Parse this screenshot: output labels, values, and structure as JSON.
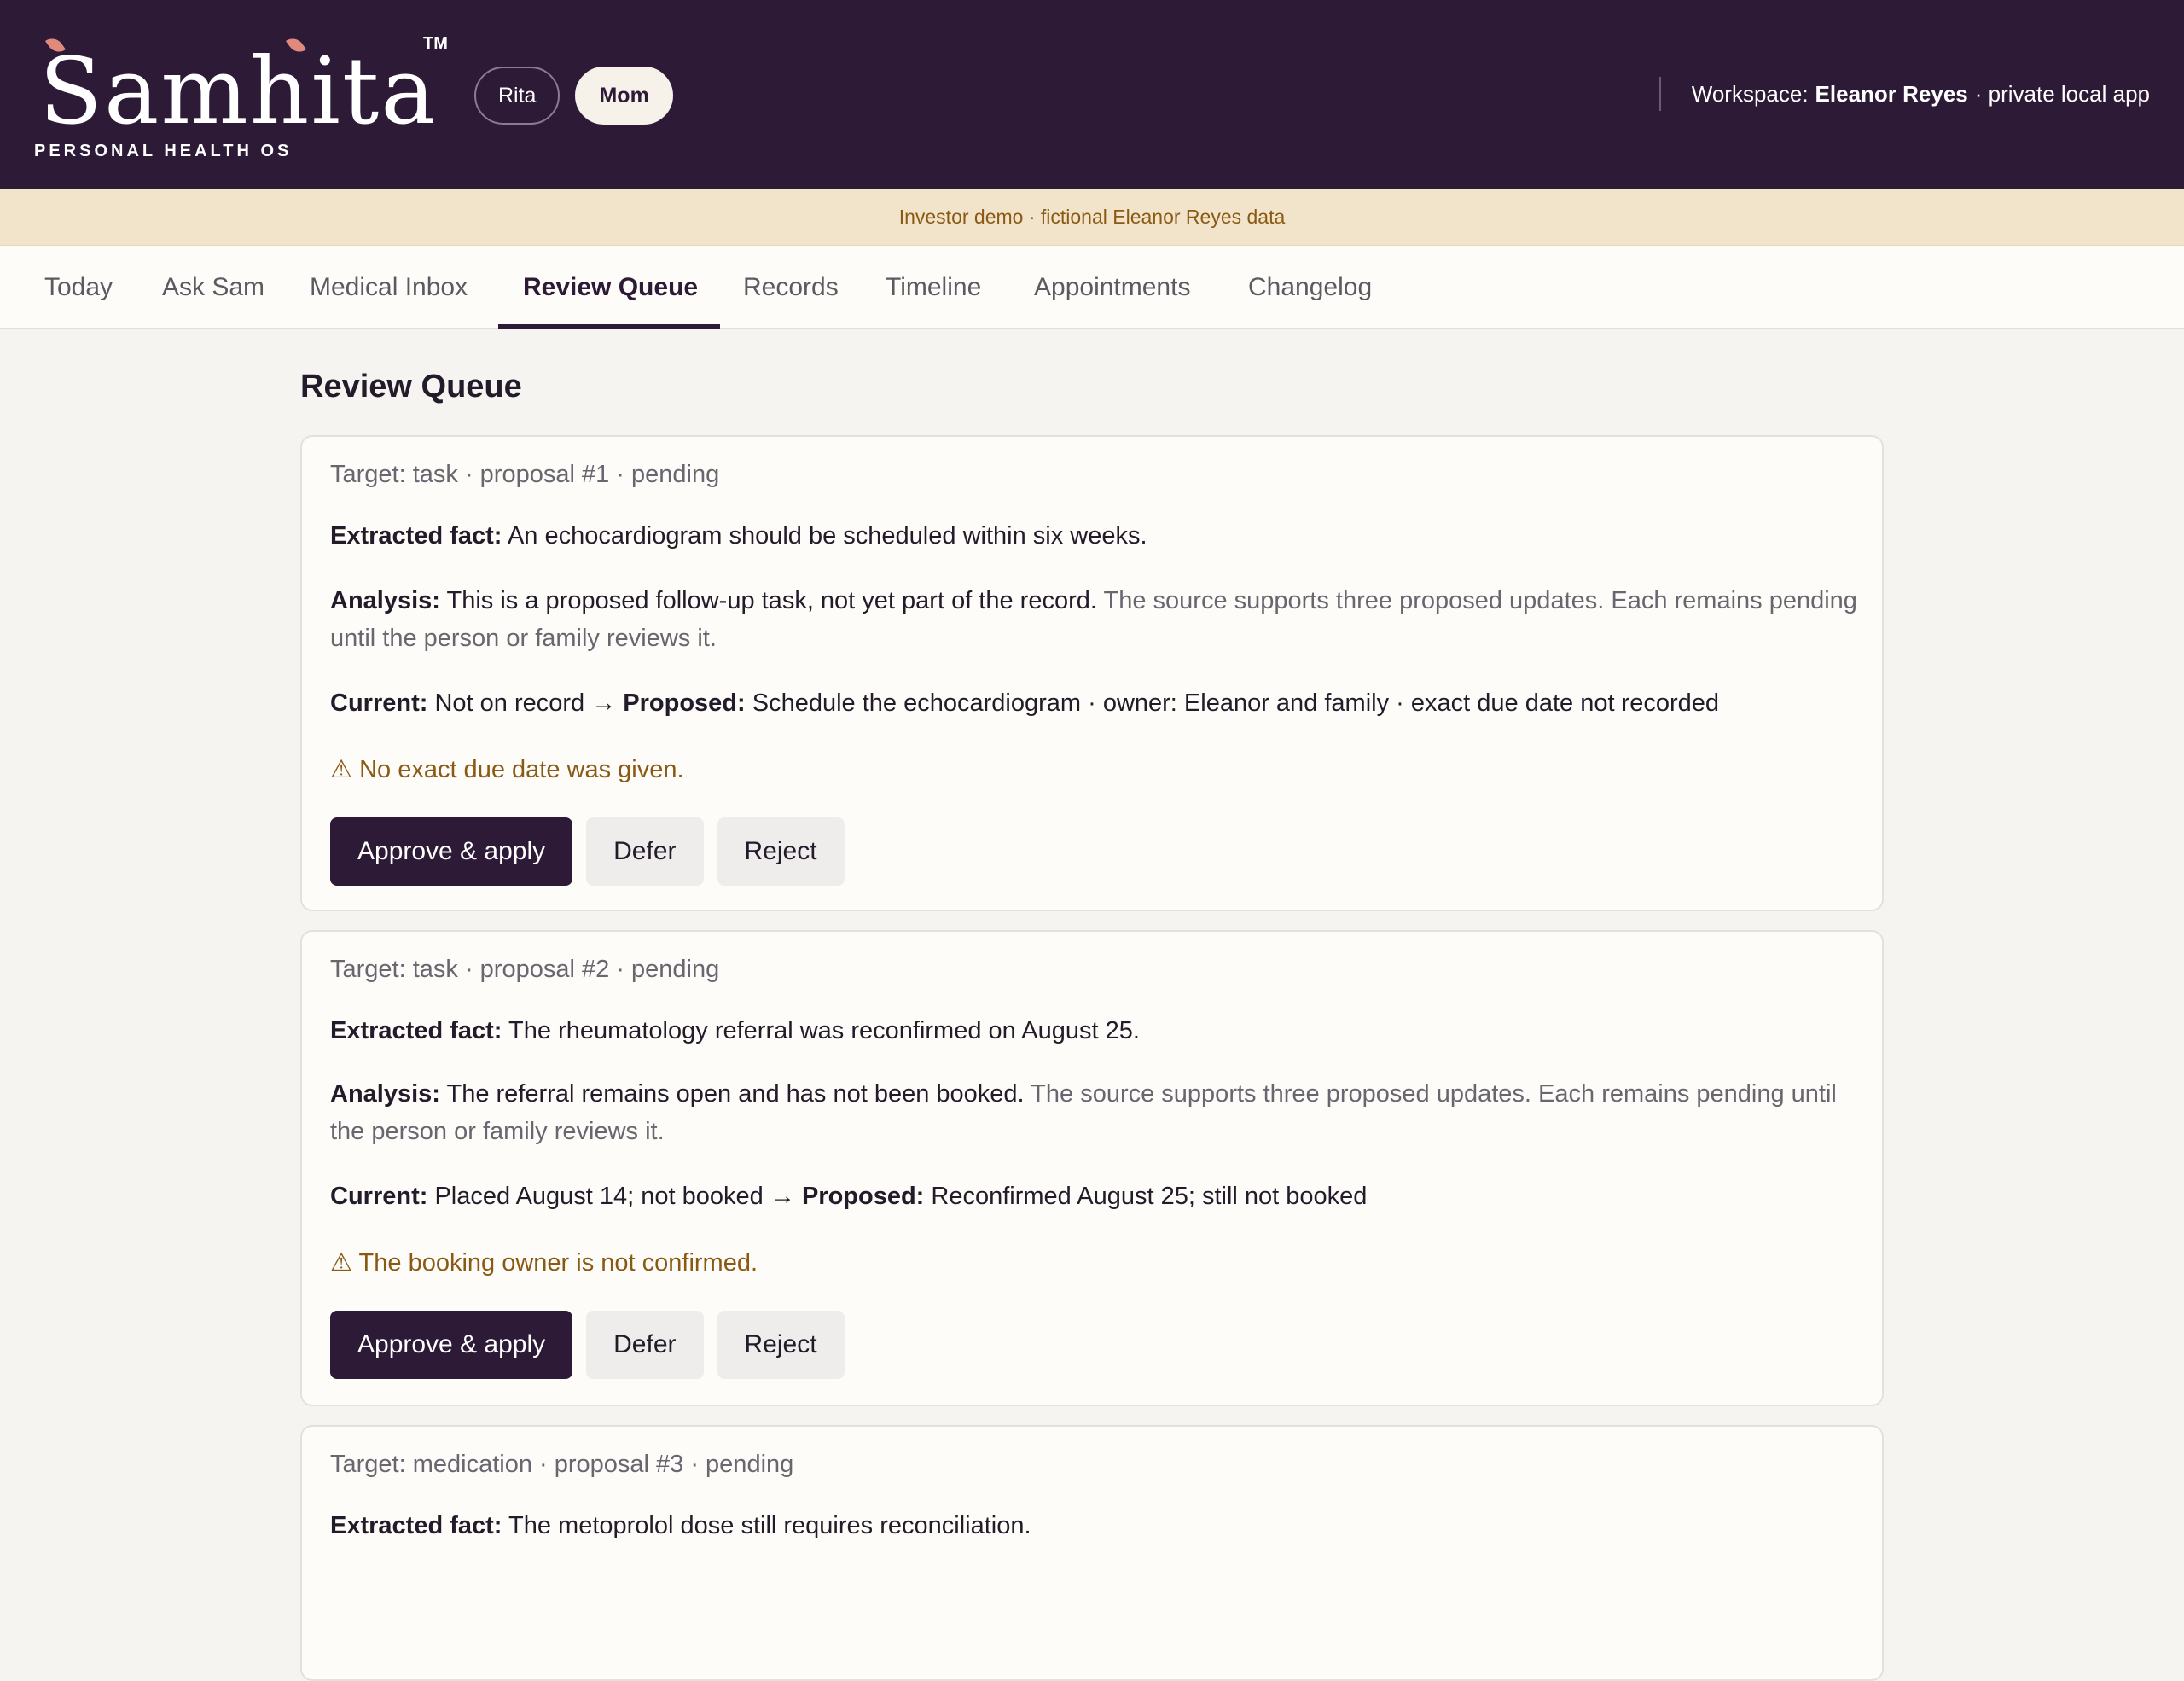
{
  "brand": {
    "name": "Samhita",
    "trademark": "TM",
    "tagline": "PERSONAL HEALTH OS"
  },
  "profiles": [
    {
      "label": "Rita",
      "active": false
    },
    {
      "label": "Mom",
      "active": true
    }
  ],
  "workspace": {
    "prefix": "Workspace:",
    "name": "Eleanor Reyes",
    "suffix": "· private local app"
  },
  "banner": "Investor demo · fictional Eleanor Reyes data",
  "nav": {
    "tabs": [
      "Today",
      "Ask Sam",
      "Medical Inbox",
      "Review Queue",
      "Records",
      "Timeline",
      "Appointments",
      "Changelog"
    ],
    "active": "Review Queue"
  },
  "page_title": "Review Queue",
  "labels": {
    "extracted_fact": "Extracted fact:",
    "analysis": "Analysis:",
    "current": "Current:",
    "proposed": "Proposed:",
    "arrow": "→",
    "warning_icon": "⚠"
  },
  "proposals": [
    {
      "meta": "Target: task · proposal #1 · pending",
      "fact": "An echocardiogram should be scheduled within six weeks.",
      "analysis": "This is a proposed follow-up task, not yet part of the record.",
      "analysis_note": "The source supports three proposed updates. Each remains pending until the person or family reviews it.",
      "current": "Not on record",
      "proposed": "Schedule the echocardiogram · owner: Eleanor and family · exact due date not recorded",
      "warning": "No exact due date was given.",
      "actions": {
        "approve": "Approve & apply",
        "defer": "Defer",
        "reject": "Reject"
      }
    },
    {
      "meta": "Target: task · proposal #2 · pending",
      "fact": "The rheumatology referral was reconfirmed on August 25.",
      "analysis": "The referral remains open and has not been booked.",
      "analysis_note": "The source supports three proposed updates. Each remains pending until the person or family reviews it.",
      "current": "Placed August 14; not booked",
      "proposed": "Reconfirmed August 25; still not booked",
      "warning": "The booking owner is not confirmed.",
      "actions": {
        "approve": "Approve & apply",
        "defer": "Defer",
        "reject": "Reject"
      }
    },
    {
      "meta": "Target: medication · proposal #3 · pending",
      "fact": "The metoprolol dose still requires reconciliation."
    }
  ],
  "colors": {
    "header_bg": "#2d1a36",
    "banner_bg": "#f2e4ca",
    "warning": "#8a5a14",
    "primary_button": "#2d1a36",
    "logo_accent": "#e08a7c"
  }
}
